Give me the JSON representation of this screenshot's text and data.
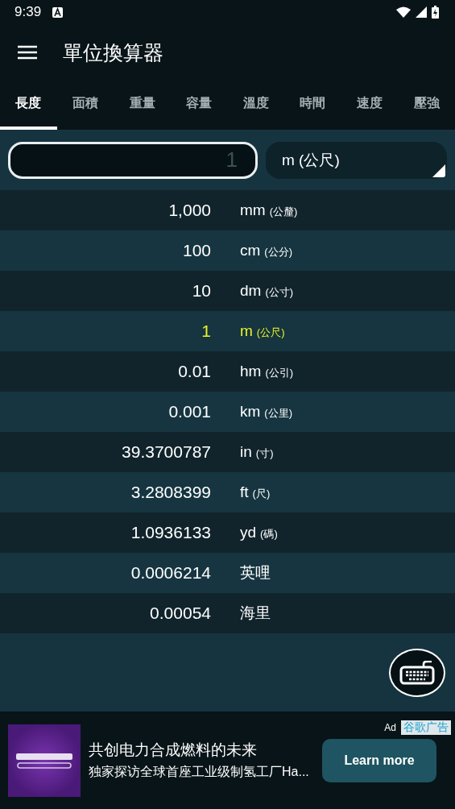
{
  "status_bar": {
    "time": "9:39"
  },
  "app_bar": {
    "title": "單位換算器"
  },
  "tabs": [
    {
      "label": "長度",
      "selected": true
    },
    {
      "label": "面積",
      "selected": false
    },
    {
      "label": "重量",
      "selected": false
    },
    {
      "label": "容量",
      "selected": false
    },
    {
      "label": "溫度",
      "selected": false
    },
    {
      "label": "時間",
      "selected": false
    },
    {
      "label": "速度",
      "selected": false
    },
    {
      "label": "壓強",
      "selected": false
    }
  ],
  "input": {
    "placeholder": "1"
  },
  "unit_select": {
    "value": "m (公尺)"
  },
  "rows": [
    {
      "value": "1,000",
      "unit": "mm",
      "note": "(公釐)",
      "selected": false
    },
    {
      "value": "100",
      "unit": "cm",
      "note": "(公分)",
      "selected": false
    },
    {
      "value": "10",
      "unit": "dm",
      "note": "(公寸)",
      "selected": false
    },
    {
      "value": "1",
      "unit": "m",
      "note": "(公尺)",
      "selected": true
    },
    {
      "value": "0.01",
      "unit": "hm",
      "note": "(公引)",
      "selected": false
    },
    {
      "value": "0.001",
      "unit": "km",
      "note": "(公里)",
      "selected": false
    },
    {
      "value": "39.3700787",
      "unit": "in",
      "note": "(寸)",
      "selected": false
    },
    {
      "value": "3.2808399",
      "unit": "ft",
      "note": "(尺)",
      "selected": false
    },
    {
      "value": "1.0936133",
      "unit": "yd",
      "note": "(碼)",
      "selected": false
    },
    {
      "value": "0.0006214",
      "unit": "英哩",
      "selected": false
    },
    {
      "value": "0.00054",
      "unit": "海里",
      "selected": false
    }
  ],
  "ad": {
    "label": "Ad",
    "network": "谷歌广告",
    "headline": "共创电力合成燃料的未来",
    "body": "独家探访全球首座工业级制氢工厂Ha...",
    "button": "Learn more"
  }
}
